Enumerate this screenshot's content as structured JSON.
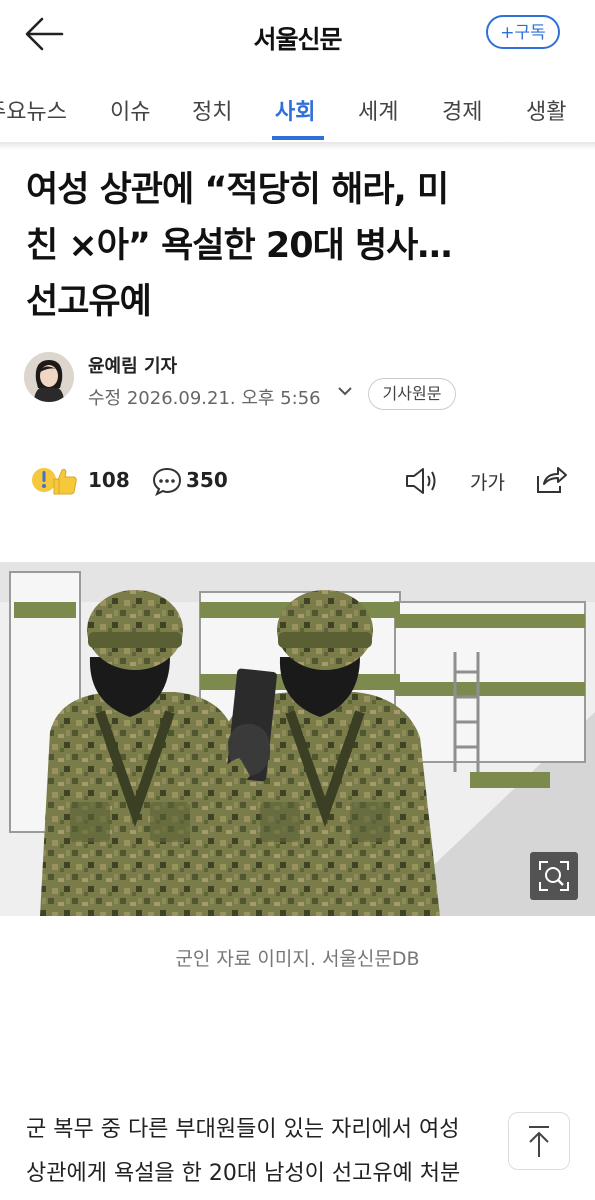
{
  "header": {
    "site_title": "서울신문",
    "subscribe_label": "+구독"
  },
  "tabs": [
    {
      "label": "주요뉴스"
    },
    {
      "label": "이슈"
    },
    {
      "label": "정치"
    },
    {
      "label": "사회",
      "active": true
    },
    {
      "label": "세계"
    },
    {
      "label": "경제"
    },
    {
      "label": "생활"
    }
  ],
  "article": {
    "headline_lines": [
      "여성 상관에 “적당히 해라, 미",
      "친 ×아” 욕설한 20대 병사…",
      "선고유예"
    ],
    "reporter": "윤예림 기자",
    "dateline": "수정 2026.09.21. 오후 5:56",
    "original_button": "기사원문",
    "reaction_count": "108",
    "comment_count": "350",
    "font_size_label": "가가",
    "image_caption": "군인 자료 이미지. 서울신문DB",
    "body_lines": [
      "군 복무 중 다른 부대원들이 있는 자리에서 여성",
      "상관에게 욕설을 한 20대 남성이 선고유예 처분"
    ]
  },
  "icons": {
    "back": "back-arrow-icon",
    "chevron": "chevron-down-icon",
    "reaction": "reaction-emoji-icon",
    "comment": "comment-bubble-icon",
    "tts": "speaker-icon",
    "font": "font-size-icon",
    "share": "share-icon",
    "zoom": "zoom-search-icon",
    "top": "scroll-top-icon"
  },
  "colors": {
    "accent": "#2f6fd8",
    "camo": "#6b7443"
  }
}
